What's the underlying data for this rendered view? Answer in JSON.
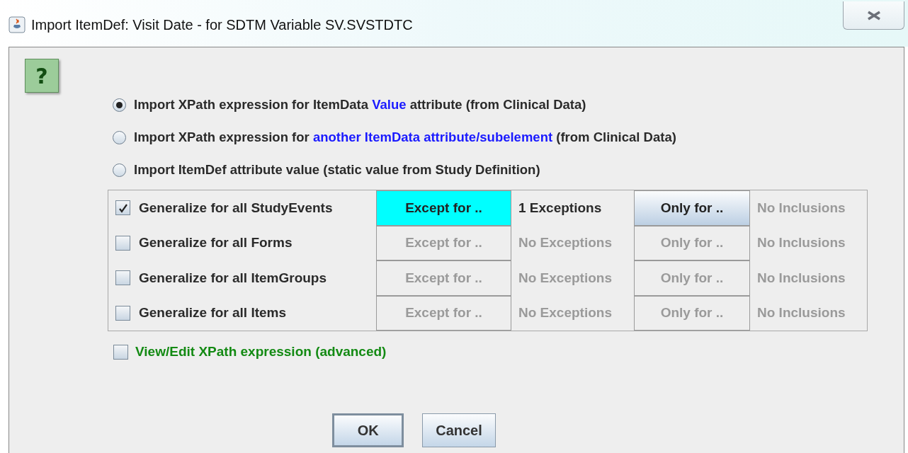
{
  "window": {
    "title": "Import ItemDef: Visit Date - for SDTM Variable SV.SVSTDTC"
  },
  "help_button": {
    "label": "?"
  },
  "options": [
    {
      "selected": true,
      "parts": [
        {
          "text": "Import XPath expression for ItemData ",
          "highlight": false
        },
        {
          "text": "Value",
          "highlight": true
        },
        {
          "text": " attribute (from Clinical Data)",
          "highlight": false
        }
      ]
    },
    {
      "selected": false,
      "parts": [
        {
          "text": "Import XPath expression for ",
          "highlight": false
        },
        {
          "text": "another ItemData attribute/subelement",
          "highlight": true
        },
        {
          "text": " (from Clinical Data)",
          "highlight": false
        }
      ]
    },
    {
      "selected": false,
      "parts": [
        {
          "text": "Import ItemDef attribute value (static value from Study Definition)",
          "highlight": false
        }
      ]
    }
  ],
  "rows": [
    {
      "label": "Generalize for all StudyEvents",
      "checked": true,
      "except_button": {
        "label": "Except for ..",
        "disabled": false,
        "highlighted": true
      },
      "exceptions": {
        "text": "1 Exceptions",
        "disabled": false
      },
      "only_button": {
        "label": "Only for ..",
        "disabled": false
      },
      "inclusions": {
        "text": "No Inclusions",
        "disabled": true
      }
    },
    {
      "label": "Generalize for all Forms",
      "checked": false,
      "except_button": {
        "label": "Except for ..",
        "disabled": true,
        "highlighted": false
      },
      "exceptions": {
        "text": "No Exceptions",
        "disabled": true
      },
      "only_button": {
        "label": "Only for ..",
        "disabled": true
      },
      "inclusions": {
        "text": "No Inclusions",
        "disabled": true
      }
    },
    {
      "label": "Generalize for all ItemGroups",
      "checked": false,
      "except_button": {
        "label": "Except for ..",
        "disabled": true,
        "highlighted": false
      },
      "exceptions": {
        "text": "No Exceptions",
        "disabled": true
      },
      "only_button": {
        "label": "Only for ..",
        "disabled": true
      },
      "inclusions": {
        "text": "No Inclusions",
        "disabled": true
      }
    },
    {
      "label": "Generalize for all Items",
      "checked": false,
      "except_button": {
        "label": "Except for ..",
        "disabled": true,
        "highlighted": false
      },
      "exceptions": {
        "text": "No Exceptions",
        "disabled": true
      },
      "only_button": {
        "label": "Only for ..",
        "disabled": true
      },
      "inclusions": {
        "text": "No Inclusions",
        "disabled": true
      }
    }
  ],
  "advanced": {
    "label": "View/Edit XPath expression (advanced)",
    "checked": false
  },
  "buttons": [
    "OK",
    "Cancel"
  ]
}
